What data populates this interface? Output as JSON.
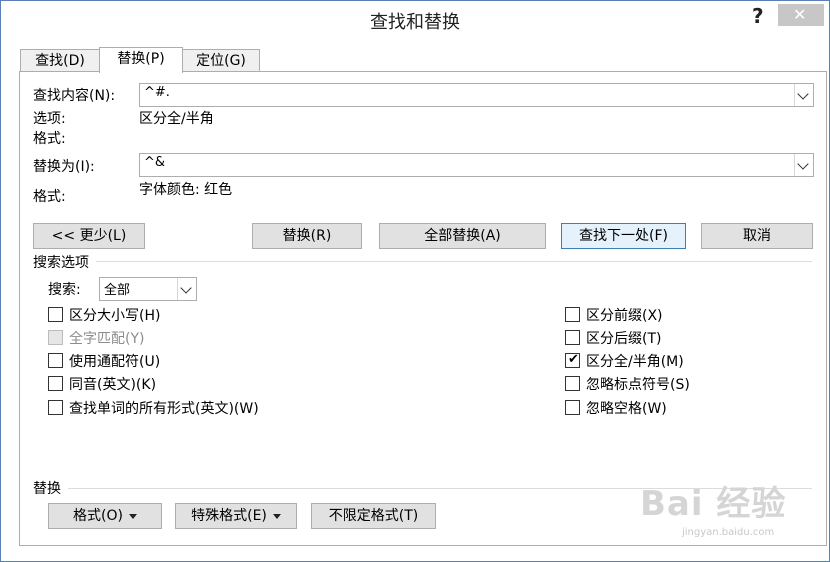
{
  "dialog": {
    "title": "查找和替换",
    "help_label": "?",
    "close_label": "✕"
  },
  "tabs": [
    {
      "label": "查找(D)",
      "active": false
    },
    {
      "label": "替换(P)",
      "active": true
    },
    {
      "label": "定位(G)",
      "active": false
    }
  ],
  "find": {
    "label": "查找内容(N):",
    "value": "^#.",
    "options_label": "选项:",
    "options_value": "区分全/半角",
    "format_label": "格式:"
  },
  "replace": {
    "label": "替换为(I):",
    "value": "^&",
    "format_label": "格式:",
    "format_value": "字体颜色: 红色"
  },
  "buttons": {
    "less": "<< 更少(L)",
    "replace": "替换(R)",
    "replace_all": "全部替换(A)",
    "find_next": "查找下一处(F)",
    "cancel": "取消"
  },
  "search_options": {
    "section_label": "搜索选项",
    "search_label": "搜索:",
    "search_value": "全部",
    "left": [
      {
        "label": "区分大小写(H)",
        "checked": false,
        "disabled": false
      },
      {
        "label": "全字匹配(Y)",
        "checked": false,
        "disabled": true
      },
      {
        "label": "使用通配符(U)",
        "checked": false,
        "disabled": false
      },
      {
        "label": "同音(英文)(K)",
        "checked": false,
        "disabled": false
      },
      {
        "label": "查找单词的所有形式(英文)(W)",
        "checked": false,
        "disabled": false
      }
    ],
    "right": [
      {
        "label": "区分前缀(X)",
        "checked": false,
        "disabled": false
      },
      {
        "label": "区分后缀(T)",
        "checked": false,
        "disabled": false
      },
      {
        "label": "区分全/半角(M)",
        "checked": true,
        "disabled": false
      },
      {
        "label": "忽略标点符号(S)",
        "checked": false,
        "disabled": false
      },
      {
        "label": "忽略空格(W)",
        "checked": false,
        "disabled": false
      }
    ]
  },
  "replace_section": {
    "label": "替换",
    "format_button": "格式(O)",
    "special_button": "特殊格式(E)",
    "no_format_button": "不限定格式(T)"
  },
  "watermark": {
    "text": "Bai 经验",
    "url": "jingyan.baidu.com"
  }
}
